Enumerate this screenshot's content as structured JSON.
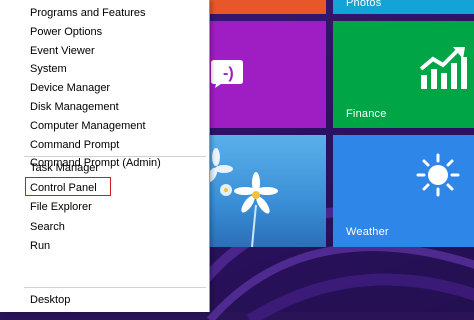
{
  "menu": {
    "items": [
      {
        "label": "Programs and Features"
      },
      {
        "label": "Power Options"
      },
      {
        "label": "Event Viewer"
      },
      {
        "label": "System"
      },
      {
        "label": "Device Manager"
      },
      {
        "label": "Disk Management"
      },
      {
        "label": "Computer Management"
      },
      {
        "label": "Command Prompt"
      },
      {
        "label": "Command Prompt (Admin)"
      },
      {
        "label": "Task Manager"
      },
      {
        "label": "Control Panel",
        "highlighted": true
      },
      {
        "label": "File Explorer"
      },
      {
        "label": "Search"
      },
      {
        "label": "Run"
      },
      {
        "label": "Desktop"
      }
    ],
    "highlight_color": "#d01c1c"
  },
  "tiles": {
    "photos": {
      "label": "Photos",
      "color": "#13a3d6"
    },
    "messaging": {
      "icon": "messaging-smiley-icon",
      "color": "#9f1ec4"
    },
    "finance": {
      "label": "Finance",
      "icon": "finance-chart-icon",
      "color": "#00a546"
    },
    "desktop": {
      "icon": "desktop-wallpaper-flowers",
      "color": "#3a8fd6"
    },
    "weather": {
      "label": "Weather",
      "icon": "sun-icon",
      "color": "#2d86e8"
    },
    "orange": {
      "color": "#e8572a"
    }
  },
  "start_background_color": "#2b1060"
}
